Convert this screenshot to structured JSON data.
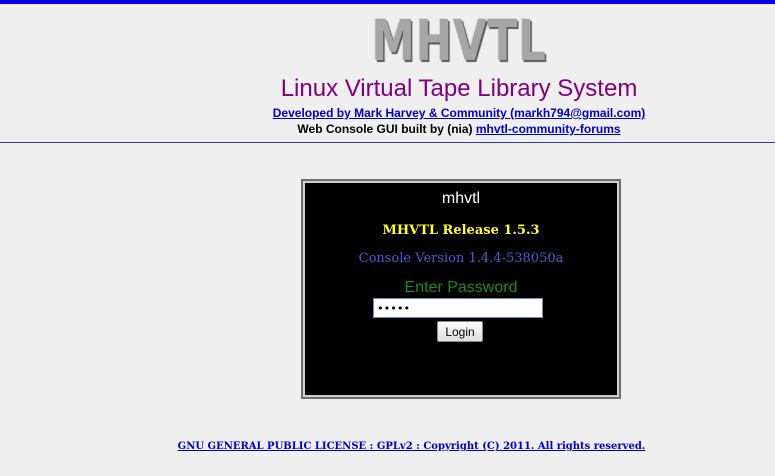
{
  "header": {
    "logo_text": "MHVTL",
    "title": "Linux Virtual Tape Library System",
    "developer_link": "Developed by Mark Harvey & Community (markh794@gmail.com)",
    "credits_prefix": "Web Console GUI built by (nia)",
    "forum_link": "mhvtl-community-forums"
  },
  "login": {
    "box_title": "mhvtl",
    "release": "MHVTL Release 1.5.3",
    "console_version": "Console Version 1.4.4-538050a",
    "password_label": "Enter Password",
    "password_value": "•••••",
    "login_button": "Login"
  },
  "footer": {
    "license_link": "GNU GENERAL PUBLIC LICENSE : GPLv2 : Copyright (C) 2011. All rights reserved."
  },
  "colors": {
    "top_bar": "#0000ee",
    "title": "#800080",
    "link": "#0000cc",
    "release": "#ffff33",
    "console": "#3a63d6",
    "password_label": "#1e8a1e"
  }
}
